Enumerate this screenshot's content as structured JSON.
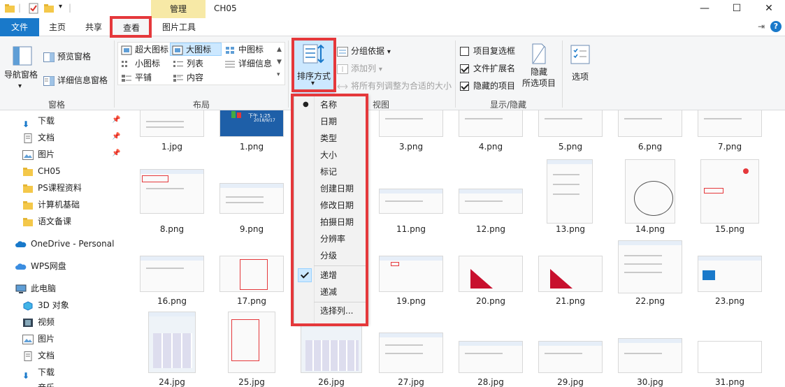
{
  "window": {
    "title": "CH05",
    "context_tab": "管理"
  },
  "tabs": {
    "file": "文件",
    "home": "主页",
    "share": "共享",
    "view": "查看",
    "picture_tools": "图片工具"
  },
  "ribbon": {
    "pane": {
      "nav_pane": "导航窗格",
      "preview_pane": "预览窗格",
      "details_pane": "详细信息窗格",
      "label": "窗格"
    },
    "layout": {
      "extra_large": "超大图标",
      "large": "大图标",
      "medium": "中图标",
      "small": "小图标",
      "list": "列表",
      "details": "详细信息",
      "tiles": "平铺",
      "content": "内容",
      "label": "布局"
    },
    "current_view": {
      "sort_by": "排序方式",
      "group_by": "分组依据",
      "add_column": "添加列",
      "size_columns": "将所有列调整为合适的大小",
      "label_partial": "视图"
    },
    "show_hide": {
      "item_checkboxes": "项目复选框",
      "file_ext": "文件扩展名",
      "hidden_items": "隐藏的项目",
      "hide_selected_line1": "隐藏",
      "hide_selected_line2": "所选项目",
      "label": "显示/隐藏"
    },
    "options": "选项"
  },
  "nav": {
    "items": [
      "下载",
      "文档",
      "图片",
      "CH05",
      "PS课程资料",
      "计算机基础",
      "语文备课",
      "OneDrive - Personal",
      "WPS网盘",
      "此电脑",
      "3D 对象",
      "视频",
      "图片",
      "文档",
      "下载",
      "音乐"
    ]
  },
  "sort_menu": {
    "items": [
      "名称",
      "日期",
      "类型",
      "大小",
      "标记",
      "创建日期",
      "修改日期",
      "拍摄日期",
      "分辨率",
      "分级"
    ],
    "order": [
      "递增",
      "递减"
    ],
    "choose": "选择列...",
    "selected_item": "名称",
    "selected_order": "递增"
  },
  "files": {
    "row1": [
      "1.jpg",
      "1.png",
      "3.png",
      "4.png",
      "5.png",
      "6.png",
      "7.png"
    ],
    "row2": [
      "8.png",
      "9.png",
      "11.png",
      "12.png",
      "13.png",
      "14.png",
      "15.png"
    ],
    "row3": [
      "16.png",
      "17.png",
      "19.png",
      "20.png",
      "21.png",
      "22.png",
      "23.png"
    ],
    "row4": [
      "24.jpg",
      "25.jpg",
      "26.jpg",
      "27.jpg",
      "28.jpg",
      "29.jpg",
      "30.jpg",
      "31.png"
    ]
  },
  "thumb_text": {
    "date": "2018/9/17",
    "time": "下午 1:25"
  },
  "colors": {
    "accent": "#1979ca",
    "highlight": "#e5383b",
    "selection": "#cce8ff"
  }
}
